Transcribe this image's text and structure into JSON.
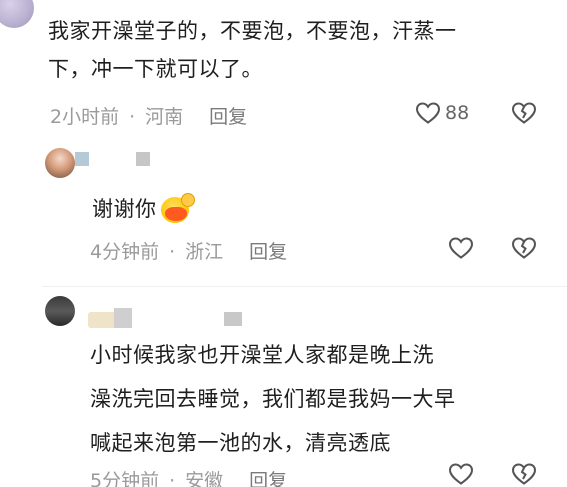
{
  "main_comment": {
    "text_line1": "我家开澡堂子的，不要泡，不要泡，汗蒸一",
    "text_line2": "下，冲一下就可以了。",
    "time": "2小时前",
    "location": "河南",
    "reply_label": "回复",
    "like_count": "88"
  },
  "replies": [
    {
      "text": "谢谢你",
      "emoji": "laughing-face-emoji",
      "time": "4分钟前",
      "location": "浙江",
      "reply_label": "回复"
    },
    {
      "text_line1": "小时候我家也开澡堂人家都是晚上洗",
      "text_line2": "澡洗完回去睡觉，我们都是我妈一大早",
      "text_line3": "喊起来泡第一池的水，清亮透底",
      "time": "5分钟前",
      "location": "安徽",
      "reply_label": "回复"
    }
  ],
  "icons": {
    "like": "heart-outline-icon",
    "dislike": "broken-heart-icon"
  },
  "colors": {
    "text": "#1f1f1f",
    "meta": "#9a9a9a",
    "icon": "#555555"
  }
}
